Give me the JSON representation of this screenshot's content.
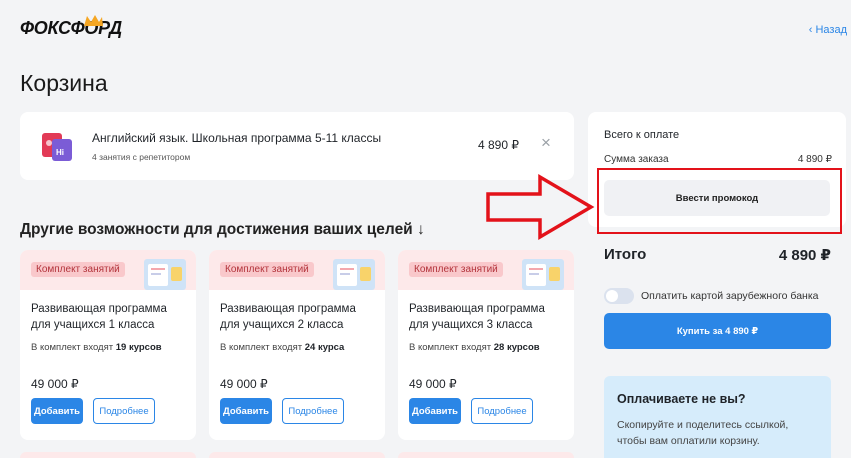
{
  "brand": {
    "logo_text": "ФОКСФОРД"
  },
  "nav": {
    "back_label": "Назад"
  },
  "page": {
    "title": "Корзина"
  },
  "cart": {
    "item": {
      "name": "Английский язык. Школьная программа 5-11 классы",
      "subtitle": "4 занятия с репетитором",
      "price": "4 890 ₽",
      "remove_icon": "close-icon"
    }
  },
  "section": {
    "title": "Другие возможности для достижения ваших целей ↓"
  },
  "cards": [
    {
      "badge": "Комплект занятий",
      "title_line1": "Развивающая программа",
      "title_line2": "для учащихся 1 класса",
      "count_prefix": "В комплект входят",
      "count_value": "19 курсов",
      "price": "49 000 ₽",
      "add_label": "Добавить",
      "more_label": "Подробнее"
    },
    {
      "badge": "Комплект занятий",
      "title_line1": "Развивающая программа",
      "title_line2": "для учащихся 2 класса",
      "count_prefix": "В комплект входят",
      "count_value": "24 курса",
      "price": "49 000 ₽",
      "add_label": "Добавить",
      "more_label": "Подробнее"
    },
    {
      "badge": "Комплект занятий",
      "title_line1": "Развивающая программа",
      "title_line2": "для учащихся 3 класса",
      "count_prefix": "В комплект входят",
      "count_value": "28 курсов",
      "price": "49 000 ₽",
      "add_label": "Добавить",
      "more_label": "Подробнее"
    }
  ],
  "summary": {
    "title": "Всего к оплате",
    "order_label": "Сумма заказа",
    "order_value": "4 890 ₽",
    "promo_label": "Ввести промокод",
    "total_label": "Итого",
    "total_value": "4 890 ₽",
    "foreign_card_label": "Оплатить картой зарубежного банка",
    "foreign_card_enabled": false,
    "buy_label": "Купить за 4 890 ₽"
  },
  "other_payer": {
    "title": "Оплачиваете не вы?",
    "text": "Скопируйте и поделитесь ссылкой, чтобы вам оплатили корзину."
  },
  "colors": {
    "accent": "#2b86e6",
    "badge_bg": "#f9c8cb",
    "badge_text": "#b3343c",
    "annotation": "#e3121a"
  }
}
